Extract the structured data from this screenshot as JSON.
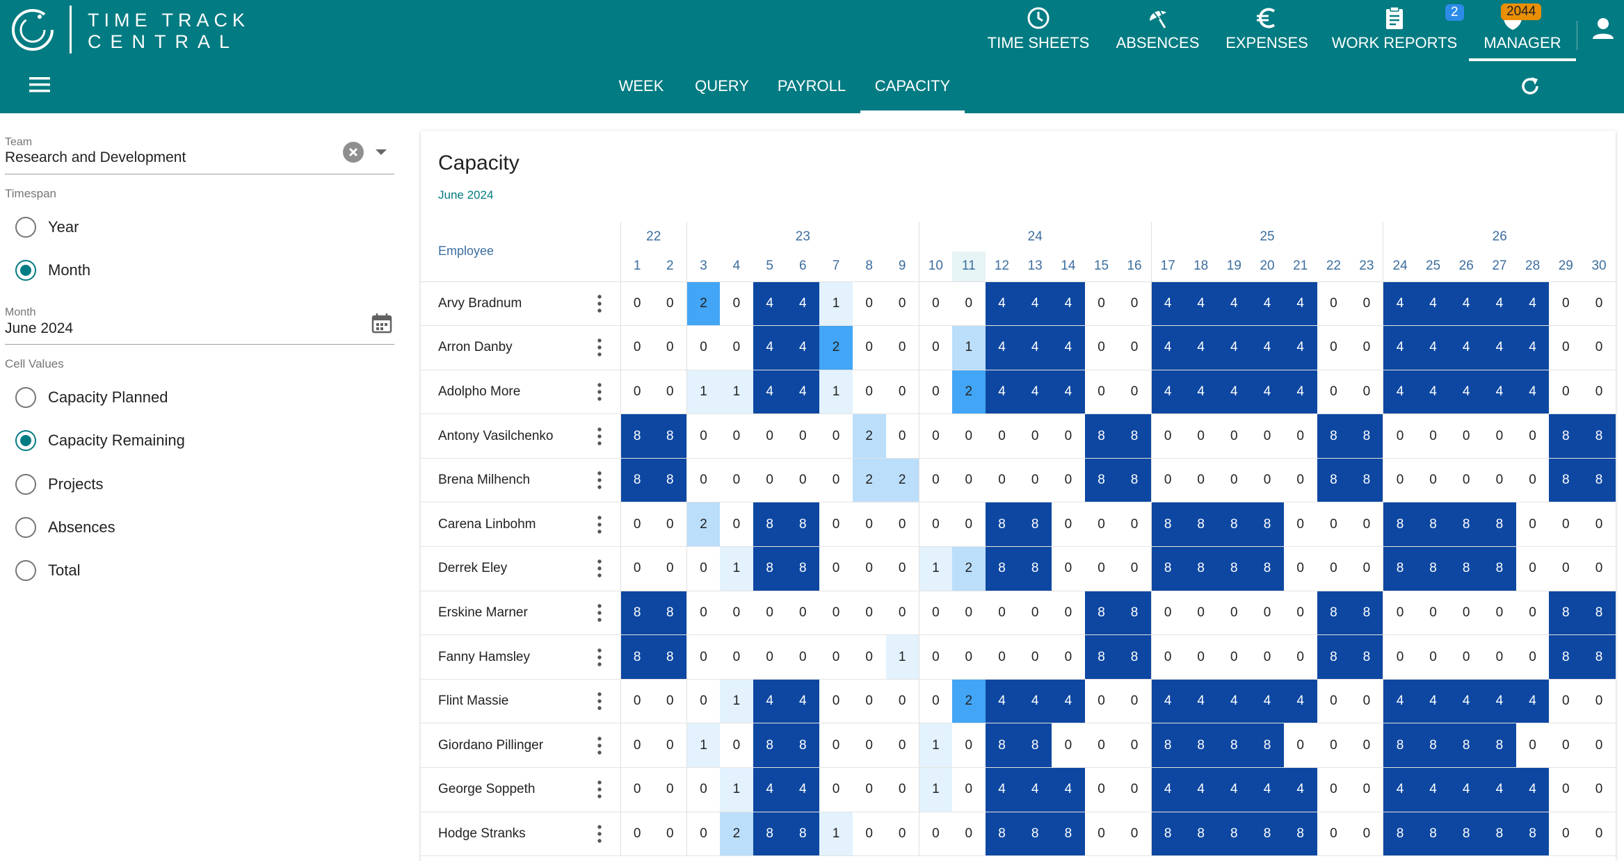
{
  "brand": {
    "line1": "TIME TRACK",
    "line2": "CENTRAL"
  },
  "top_nav": [
    {
      "label": "TIME SHEETS",
      "icon": "clock-icon"
    },
    {
      "label": "ABSENCES",
      "icon": "umbrella-icon"
    },
    {
      "label": "EXPENSES",
      "icon": "euro-icon"
    },
    {
      "label": "WORK REPORTS",
      "icon": "clipboard-icon",
      "badge": "2"
    },
    {
      "label": "MANAGER",
      "icon": "shield-icon",
      "badge": "2044",
      "active": true
    }
  ],
  "sub_nav": [
    {
      "label": "WEEK"
    },
    {
      "label": "QUERY"
    },
    {
      "label": "PAYROLL"
    },
    {
      "label": "CAPACITY",
      "active": true
    }
  ],
  "filters": {
    "team_label": "Team",
    "team_value": "Research and Development",
    "timespan_label": "Timespan",
    "timespan_options": [
      "Year",
      "Month"
    ],
    "timespan_selected": "Month",
    "month_label": "Month",
    "month_value": "June 2024",
    "cell_values_label": "Cell Values",
    "cell_values_options": [
      "Capacity Planned",
      "Capacity Remaining",
      "Projects",
      "Absences",
      "Total"
    ],
    "cell_values_selected": "Capacity Remaining"
  },
  "card": {
    "title": "Capacity",
    "subtitle": "June 2024",
    "employee_header": "Employee"
  },
  "weeks": [
    {
      "label": "22",
      "span": 2
    },
    {
      "label": "23",
      "span": 7
    },
    {
      "label": "24",
      "span": 7
    },
    {
      "label": "25",
      "span": 7
    },
    {
      "label": "26",
      "span": 7
    }
  ],
  "days": [
    "1",
    "2",
    "3",
    "4",
    "5",
    "6",
    "7",
    "8",
    "9",
    "10",
    "11",
    "12",
    "13",
    "14",
    "15",
    "16",
    "17",
    "18",
    "19",
    "20",
    "21",
    "22",
    "23",
    "24",
    "25",
    "26",
    "27",
    "28",
    "29",
    "30"
  ],
  "today_day": "11",
  "rows": [
    {
      "name": "Arvy Bradnum",
      "values": [
        0,
        0,
        2,
        0,
        4,
        4,
        1,
        0,
        0,
        0,
        0,
        4,
        4,
        4,
        0,
        0,
        4,
        4,
        4,
        4,
        4,
        0,
        0,
        4,
        4,
        4,
        4,
        4,
        0,
        0
      ]
    },
    {
      "name": "Arron Danby",
      "values": [
        0,
        0,
        0,
        0,
        4,
        4,
        2,
        0,
        0,
        0,
        1,
        4,
        4,
        4,
        0,
        0,
        4,
        4,
        4,
        4,
        4,
        0,
        0,
        4,
        4,
        4,
        4,
        4,
        0,
        0
      ]
    },
    {
      "name": "Adolpho More",
      "values": [
        0,
        0,
        1,
        1,
        4,
        4,
        1,
        0,
        0,
        0,
        2,
        4,
        4,
        4,
        0,
        0,
        4,
        4,
        4,
        4,
        4,
        0,
        0,
        4,
        4,
        4,
        4,
        4,
        0,
        0
      ]
    },
    {
      "name": "Antony Vasilchenko",
      "values": [
        8,
        8,
        0,
        0,
        0,
        0,
        0,
        2,
        0,
        0,
        0,
        0,
        0,
        0,
        8,
        8,
        0,
        0,
        0,
        0,
        0,
        8,
        8,
        0,
        0,
        0,
        0,
        0,
        8,
        8
      ]
    },
    {
      "name": "Brena Milhench",
      "values": [
        8,
        8,
        0,
        0,
        0,
        0,
        0,
        2,
        2,
        0,
        0,
        0,
        0,
        0,
        8,
        8,
        0,
        0,
        0,
        0,
        0,
        8,
        8,
        0,
        0,
        0,
        0,
        0,
        8,
        8
      ]
    },
    {
      "name": "Carena Linbohm",
      "values": [
        0,
        0,
        2,
        0,
        8,
        8,
        0,
        0,
        0,
        0,
        0,
        8,
        8,
        0,
        0,
        0,
        8,
        8,
        8,
        8,
        0,
        0,
        0,
        8,
        8,
        8,
        8,
        0,
        0,
        0
      ]
    },
    {
      "name": "Derrek Eley",
      "values": [
        0,
        0,
        0,
        1,
        8,
        8,
        0,
        0,
        0,
        1,
        2,
        8,
        8,
        0,
        0,
        0,
        8,
        8,
        8,
        8,
        0,
        0,
        0,
        8,
        8,
        8,
        8,
        0,
        0,
        0
      ]
    },
    {
      "name": "Erskine Marner",
      "values": [
        8,
        8,
        0,
        0,
        0,
        0,
        0,
        0,
        0,
        0,
        0,
        0,
        0,
        0,
        8,
        8,
        0,
        0,
        0,
        0,
        0,
        8,
        8,
        0,
        0,
        0,
        0,
        0,
        8,
        8
      ]
    },
    {
      "name": "Fanny Hamsley",
      "values": [
        8,
        8,
        0,
        0,
        0,
        0,
        0,
        0,
        1,
        0,
        0,
        0,
        0,
        0,
        8,
        8,
        0,
        0,
        0,
        0,
        0,
        8,
        8,
        0,
        0,
        0,
        0,
        0,
        8,
        8
      ]
    },
    {
      "name": "Flint Massie",
      "values": [
        0,
        0,
        0,
        1,
        4,
        4,
        0,
        0,
        0,
        0,
        2,
        4,
        4,
        4,
        0,
        0,
        4,
        4,
        4,
        4,
        4,
        0,
        0,
        4,
        4,
        4,
        4,
        4,
        0,
        0
      ]
    },
    {
      "name": "Giordano Pillinger",
      "values": [
        0,
        0,
        1,
        0,
        8,
        8,
        0,
        0,
        0,
        1,
        0,
        8,
        8,
        0,
        0,
        0,
        8,
        8,
        8,
        8,
        0,
        0,
        0,
        8,
        8,
        8,
        8,
        0,
        0,
        0
      ]
    },
    {
      "name": "George Soppeth",
      "values": [
        0,
        0,
        0,
        1,
        4,
        4,
        0,
        0,
        0,
        1,
        0,
        4,
        4,
        4,
        0,
        0,
        4,
        4,
        4,
        4,
        4,
        0,
        0,
        4,
        4,
        4,
        4,
        4,
        0,
        0
      ]
    },
    {
      "name": "Hodge Stranks",
      "values": [
        0,
        0,
        0,
        2,
        8,
        8,
        1,
        0,
        0,
        0,
        0,
        8,
        8,
        8,
        0,
        0,
        8,
        8,
        8,
        8,
        8,
        0,
        0,
        8,
        8,
        8,
        8,
        8,
        0,
        0
      ]
    }
  ],
  "highlight_cells": [
    {
      "row": 0,
      "day": 3
    },
    {
      "row": 1,
      "day": 7
    },
    {
      "row": 2,
      "day": 11
    },
    {
      "row": 9,
      "day": 11
    },
    {
      "row": 1,
      "day": 11
    }
  ]
}
